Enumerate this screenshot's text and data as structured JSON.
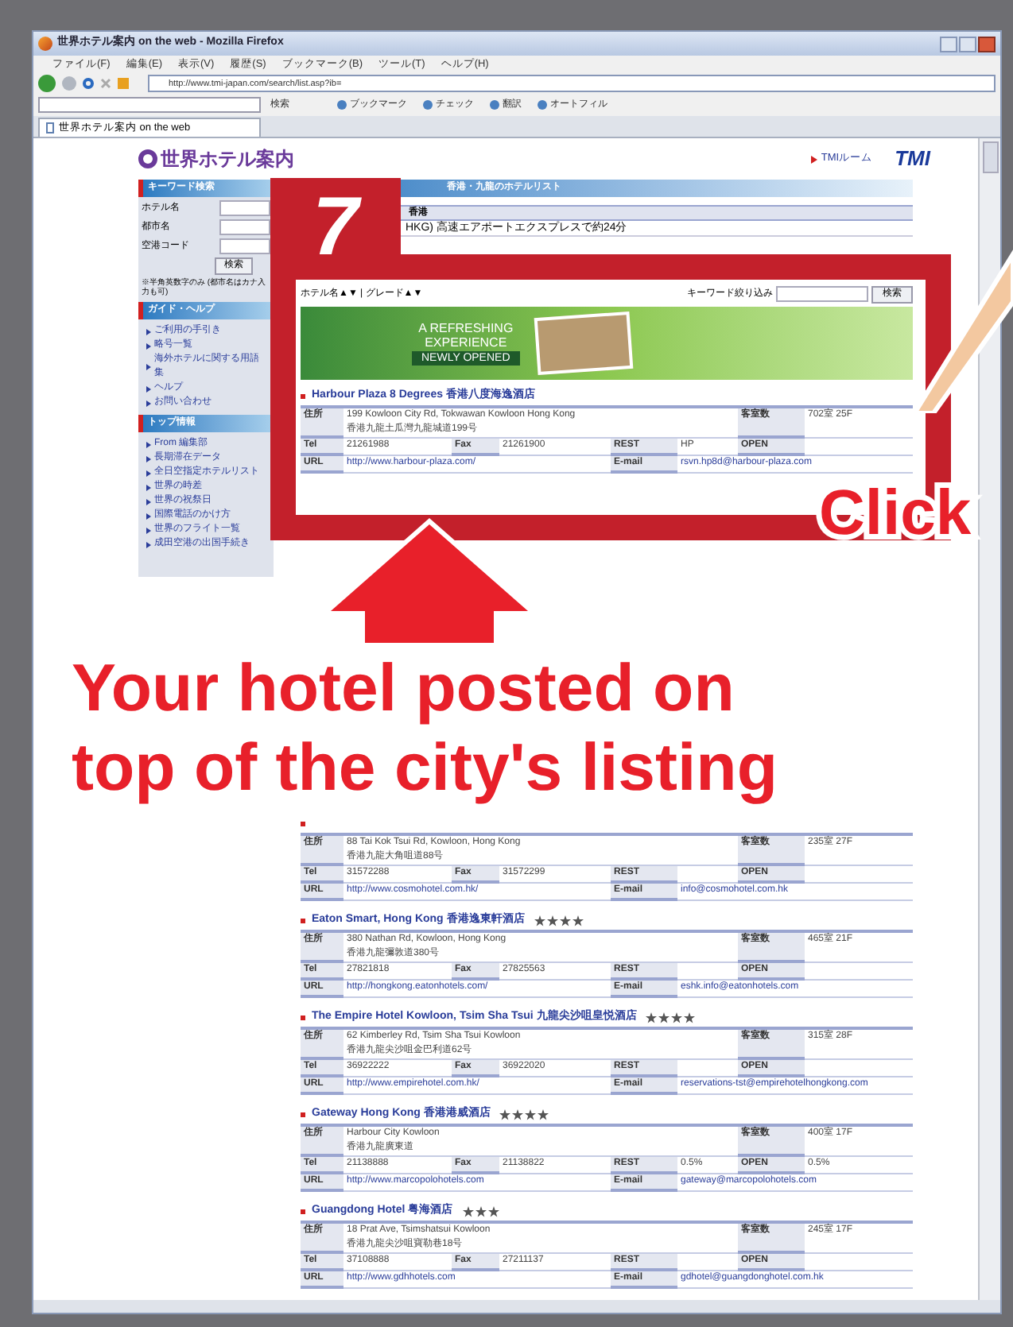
{
  "window": {
    "title": "世界ホテル案内 on the web - Mozilla Firefox"
  },
  "menu": [
    "ファイル(F)",
    "編集(E)",
    "表示(V)",
    "履歴(S)",
    "ブックマーク(B)",
    "ツール(T)",
    "ヘルプ(H)"
  ],
  "address_bar": {
    "value": "http://www.tmi-japan.com/search/list.asp?ib="
  },
  "bookmarks_bar": [
    {
      "kind": "search",
      "label": "検索"
    },
    {
      "kind": "link",
      "label": "ブックマーク"
    },
    {
      "kind": "link",
      "label": "チェック"
    },
    {
      "kind": "link",
      "label": "翻訳"
    },
    {
      "kind": "link",
      "label": "オートフィル"
    }
  ],
  "tabs": [
    {
      "label": "世界ホテル案内 on the web",
      "selected": true
    }
  ],
  "page": {
    "logo": "世界ホテル案内",
    "top_link": "TMIルーム",
    "company_logo": "TMI",
    "sidebar": {
      "search_title": "キーワード検索",
      "fields": [
        {
          "label": "ホテル名"
        },
        {
          "label": "都市名"
        },
        {
          "label": "空港コード"
        }
      ],
      "button": "検索",
      "note": "※半角英数字のみ (都市名はカナ入力も可)",
      "sections": [
        {
          "title": "ガイド・ヘルプ",
          "items": [
            "ご利用の手引き",
            "略号一覧",
            "海外ホテルに関する用語集",
            "ヘルプ",
            "お問い合わせ"
          ]
        },
        {
          "title": "トップ情報",
          "items": [
            "From 編集部",
            "長期滞在データ",
            "全日空指定ホテルリスト",
            "世界の時差",
            "世界の祝祭日",
            "国際電話のかけ方",
            "世界のフライト一覧",
            "成田空港の出国手続き"
          ]
        }
      ]
    },
    "breadcrumb": "香港・九龍のホテルリスト",
    "city": "香港",
    "airport_note": "HKG) 高速エアポートエクスプレスで約24分",
    "sort": "ホテル名▲▼ | グレード▲▼",
    "keyword_label": "キーワード絞り込み",
    "keyword_button": "検索",
    "banner": {
      "line1": "A REFRESHING",
      "line2": "EXPERIENCE",
      "badge": "NEWLY OPENED"
    },
    "hotels": [
      {
        "name": "Harbour Plaza 8 Degrees 香港八度海逸酒店",
        "rows": [
          {
            "kind": "address",
            "cells": [
              {
                "label": "住所",
                "value": "199 Kowloon City Rd, Tokwawan Kowloon Hong Kong",
                "value2": "香港九龍土瓜灣九龍城道199号"
              },
              "",
              "",
              {
                "label": "客室数",
                "value": "702室 25F"
              }
            ]
          },
          {
            "kind": "contact",
            "cells": [
              {
                "label": "Tel",
                "value": "21261988"
              },
              {
                "label": "Fax",
                "value": "21261900"
              },
              {
                "label": "REST",
                "value": "HP"
              },
              {
                "label": "OPEN"
              }
            ]
          },
          {
            "kind": "web",
            "cells": [
              {
                "label": "URL",
                "value": "http://www.harbour-plaza.com/"
              },
              "",
              {
                "label": "E-mail",
                "value": "rsvn.hp8d@harbour-plaza.com"
              }
            ]
          }
        ]
      },
      {
        "rows": [
          {
            "kind": "address",
            "cells": [
              {
                "label": "住所",
                "value": "88 Tai Kok Tsui Rd, Kowloon, Hong Kong",
                "value2": "香港九龍大角咀道88号"
              },
              "",
              "",
              {
                "label": "客室数",
                "value": "235室 27F"
              }
            ]
          },
          {
            "kind": "contact",
            "cells": [
              {
                "label": "Tel",
                "value": "31572288"
              },
              {
                "label": "Fax",
                "value": "31572299"
              },
              {
                "label": "REST"
              },
              {
                "label": "OPEN"
              }
            ]
          },
          {
            "kind": "web",
            "cells": [
              {
                "label": "URL",
                "value": "http://www.cosmohotel.com.hk/"
              },
              "",
              {
                "label": "E-mail",
                "value": "info@cosmohotel.com.hk"
              }
            ]
          }
        ]
      },
      {
        "name": "Eaton Smart, Hong Kong 香港逸東軒酒店",
        "stars": 4,
        "rows": [
          {
            "kind": "address",
            "cells": [
              {
                "label": "住所",
                "value": "380 Nathan Rd, Kowloon, Hong Kong",
                "value2": "香港九龍彌敦道380号"
              },
              "",
              "",
              {
                "label": "客室数",
                "value": "465室 21F"
              }
            ]
          },
          {
            "kind": "contact",
            "cells": [
              {
                "label": "Tel",
                "value": "27821818"
              },
              {
                "label": "Fax",
                "value": "27825563"
              },
              {
                "label": "REST"
              },
              {
                "label": "OPEN"
              }
            ]
          },
          {
            "kind": "web",
            "cells": [
              {
                "label": "URL",
                "value": "http://hongkong.eatonhotels.com/"
              },
              "",
              {
                "label": "E-mail",
                "value": "eshk.info@eatonhotels.com"
              }
            ]
          }
        ]
      },
      {
        "name": "The Empire Hotel Kowloon, Tsim Sha Tsui 九龍尖沙咀皇悦酒店",
        "stars": 4,
        "rows": [
          {
            "kind": "address",
            "cells": [
              {
                "label": "住所",
                "value": "62 Kimberley Rd, Tsim Sha Tsui Kowloon",
                "value2": "香港九龍尖沙咀金巴利道62号"
              },
              "",
              "",
              {
                "label": "客室数",
                "value": "315室 28F"
              }
            ]
          },
          {
            "kind": "contact",
            "cells": [
              {
                "label": "Tel",
                "value": "36922222"
              },
              {
                "label": "Fax",
                "value": "36922020"
              },
              {
                "label": "REST"
              },
              {
                "label": "OPEN"
              }
            ]
          },
          {
            "kind": "web",
            "cells": [
              {
                "label": "URL",
                "value": "http://www.empirehotel.com.hk/"
              },
              "",
              {
                "label": "E-mail",
                "value": "reservations-tst@empirehotelhongkong.com"
              }
            ]
          }
        ]
      },
      {
        "name": "Gateway Hong Kong 香港港威酒店",
        "stars": 4,
        "rows": [
          {
            "kind": "address",
            "cells": [
              {
                "label": "住所",
                "value": "Harbour City Kowloon",
                "value2": "香港九龍廣東道"
              },
              "",
              "",
              {
                "label": "客室数",
                "value": "400室 17F"
              }
            ]
          },
          {
            "kind": "contact",
            "cells": [
              {
                "label": "Tel",
                "value": "21138888"
              },
              {
                "label": "Fax",
                "value": "21138822"
              },
              {
                "label": "REST",
                "value": "0.5%"
              },
              {
                "label": "OPEN",
                "value": "0.5%"
              }
            ]
          },
          {
            "kind": "web",
            "cells": [
              {
                "label": "URL",
                "value": "http://www.marcopolohotels.com"
              },
              "",
              {
                "label": "E-mail",
                "value": "gateway@marcopolohotels.com"
              }
            ]
          }
        ]
      },
      {
        "name": "Guangdong Hotel 粤海酒店",
        "stars": 3,
        "rows": [
          {
            "kind": "address",
            "cells": [
              {
                "label": "住所",
                "value": "18 Prat Ave, Tsimshatsui Kowloon",
                "value2": "香港九龍尖沙咀寶勒巷18号"
              },
              "",
              "",
              {
                "label": "客室数",
                "value": "245室 17F"
              }
            ]
          },
          {
            "kind": "contact",
            "cells": [
              {
                "label": "Tel",
                "value": "37108888"
              },
              {
                "label": "Fax",
                "value": "27211137"
              },
              {
                "label": "REST"
              },
              {
                "label": "OPEN"
              }
            ]
          },
          {
            "kind": "web",
            "cells": [
              {
                "label": "URL",
                "value": "http://www.gdhhotels.com"
              },
              "",
              {
                "label": "E-mail",
                "value": "gdhotel@guangdonghotel.com.hk"
              }
            ]
          }
        ]
      }
    ]
  },
  "overlay": {
    "step": "7",
    "caption": [
      "Your hotel posted on",
      "top of the city's listing"
    ],
    "click": "Click"
  }
}
